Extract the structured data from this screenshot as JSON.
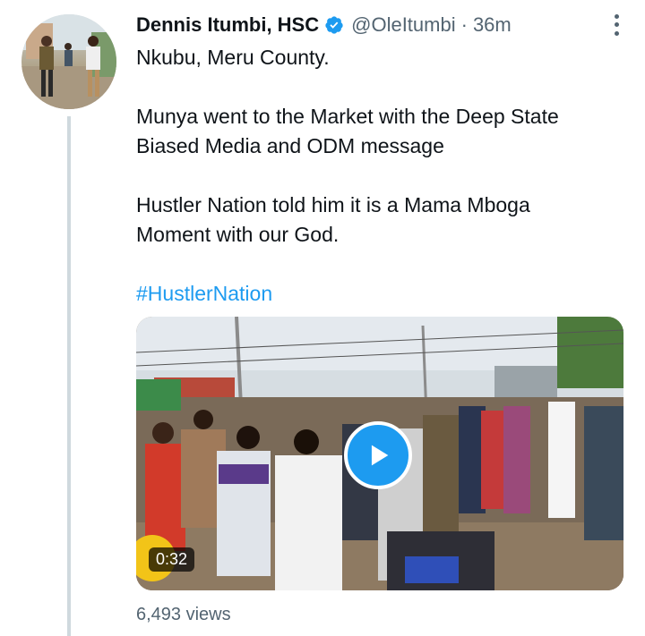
{
  "author": {
    "name": "Dennis Itumbi, HSC",
    "handle": "@OleItumbi",
    "separator": "·",
    "time": "36m"
  },
  "tweet": {
    "line1": "Nkubu, Meru County.",
    "para2_line1": "Munya went to the Market with the Deep State",
    "para2_line2": "Biased Media and ODM message",
    "para3_line1": "Hustler Nation told him it is a Mama Mboga",
    "para3_line2": "Moment with our God.",
    "hashtag": "#HustlerNation"
  },
  "media": {
    "duration": "0:32",
    "play_icon": "play-icon"
  },
  "stats": {
    "views": "6,493 views"
  },
  "colors": {
    "accent": "#1d9bf0",
    "secondary_text": "#536471",
    "thread_line": "#cfd9de"
  }
}
